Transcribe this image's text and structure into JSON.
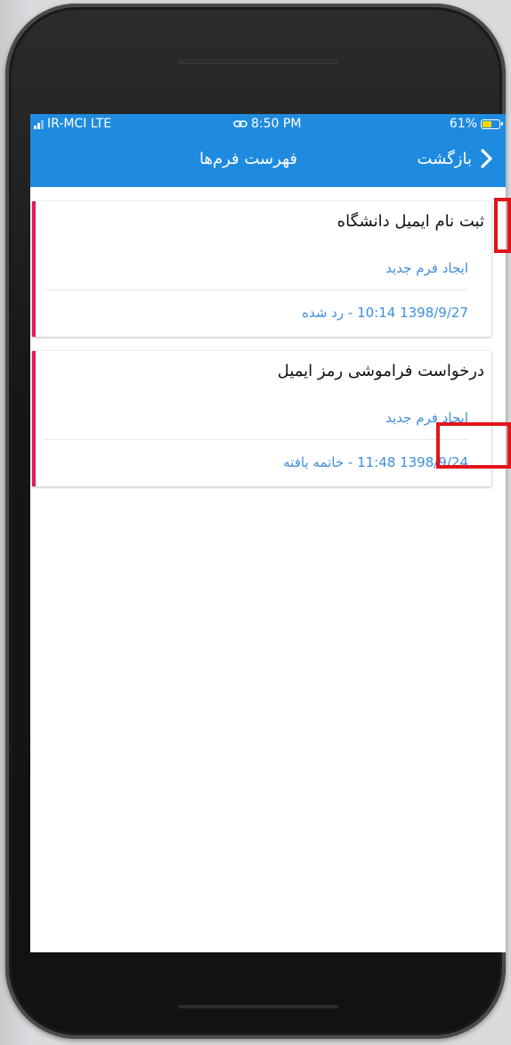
{
  "status_bar": {
    "carrier": "IR-MCI LTE",
    "time": "8:50 PM",
    "battery": "61%",
    "battery_level": 0.61
  },
  "nav": {
    "back_label": "بازگشت",
    "title": "فهرست فرم‌ها"
  },
  "forms": [
    {
      "title": "ثبت نام ایمیل دانشگاه",
      "action": "ایجاد فرم جدید",
      "status": "1398/9/27 10:14 - رد شده"
    },
    {
      "title": "درخواست فراموشی رمز ایمیل",
      "action": "ایجاد فرم جدید",
      "status": "1398/9/24 11:48 - خاتمه یافته"
    }
  ],
  "colors": {
    "primary": "#1f8be0",
    "card_accent": "#e2195e",
    "link": "#3d8fdb",
    "marker": "#e3141a"
  }
}
